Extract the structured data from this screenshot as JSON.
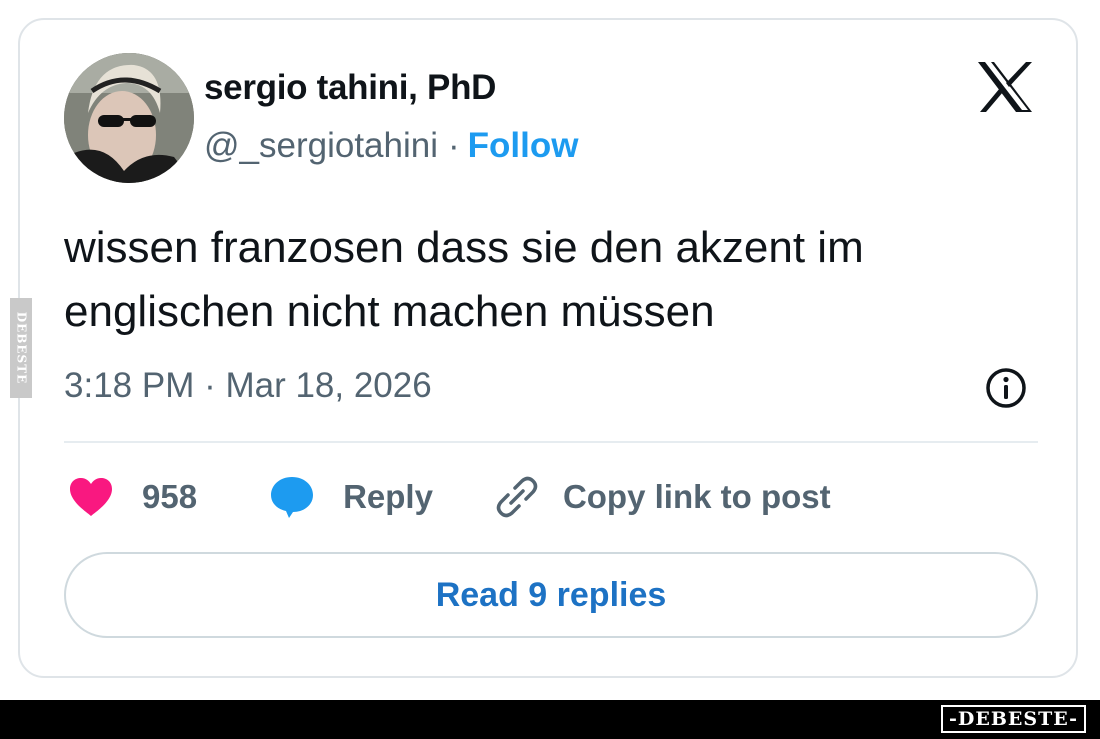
{
  "tweet": {
    "author_name": "sergio tahini, PhD",
    "handle": "@_sergiotahini",
    "separator": "·",
    "follow_label": "Follow",
    "text": "wissen franzosen dass sie den akzent im englischen nicht machen müssen",
    "timestamp": "3:18 PM · Mar 18, 2026",
    "like_count": "958",
    "reply_label": "Reply",
    "copy_link_label": "Copy link to post",
    "read_replies_label": "Read 9 replies"
  },
  "icons": {
    "platform": "x-logo-icon",
    "info": "info-icon",
    "like": "heart-icon",
    "reply": "speech-bubble-icon",
    "copy": "link-icon"
  },
  "colors": {
    "text": "#0f1419",
    "secondary": "#536471",
    "follow": "#1d9bf0",
    "heart": "#f91880",
    "reply_bubble": "#1d9bf0",
    "read_replies": "#1d72c4"
  },
  "watermark": {
    "side": "DEBESTE",
    "footer": "-DEBESTE-"
  }
}
